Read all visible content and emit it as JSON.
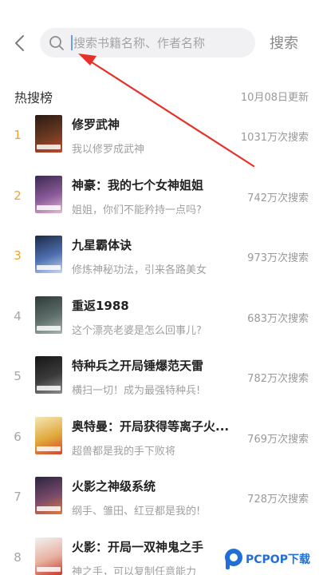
{
  "header": {
    "search_placeholder": "搜索书籍名称、作者名称",
    "search_button": "搜索"
  },
  "hot_search": {
    "title": "热搜榜",
    "updated": "10月08日更新",
    "items": [
      {
        "rank": "1",
        "title": "修罗武神",
        "desc": "我以修罗成武神",
        "count": "1031万次搜索",
        "cover": [
          "#2a1a14",
          "#6b3a22",
          "#c2472a"
        ]
      },
      {
        "rank": "2",
        "title": "神豪：我的七个女神姐姐",
        "desc": "姐姐，你们不能矜持一点吗?",
        "count": "742万次搜索",
        "cover": [
          "#3b2a4e",
          "#8a5a9a",
          "#e6b9d0"
        ]
      },
      {
        "rank": "3",
        "title": "九星霸体诀",
        "desc": "修炼神秘功法，引来各路美女",
        "count": "973万次搜索",
        "cover": [
          "#1c2a44",
          "#4e6fb0",
          "#c9d6f2"
        ]
      },
      {
        "rank": "4",
        "title": "重返1988",
        "desc": "这个漂亮老婆是怎么回事儿?",
        "count": "683万次搜索",
        "cover": [
          "#2f3a3a",
          "#5e6e6a",
          "#a9b4ad"
        ]
      },
      {
        "rank": "5",
        "title": "特种兵之开局锤爆范天雷",
        "desc": "横扫一切！成为最强特种兵!",
        "count": "782万次搜索",
        "cover": [
          "#161616",
          "#3b3b3b",
          "#8c8c8c"
        ]
      },
      {
        "rank": "6",
        "title": "奥特曼：开局获得等离子火...",
        "desc": "超兽都是我的手下败将",
        "count": "769万次搜索",
        "cover": [
          "#f4e7b6",
          "#e0a83a",
          "#d8432f"
        ]
      },
      {
        "rank": "7",
        "title": "火影之神级系统",
        "desc": "纲手、雏田、红豆都是我的!",
        "count": "728万次搜索",
        "cover": [
          "#2b2440",
          "#7a4a6a",
          "#e07a3a"
        ]
      },
      {
        "rank": "8",
        "title": "火影：开局一双神鬼之手",
        "desc": "神之手，可以复制任意能力",
        "count": "",
        "cover": [
          "#f2f2f2",
          "#e8b0a0",
          "#c83a2a"
        ]
      }
    ]
  },
  "watermark": {
    "text": "PCPOP下载"
  }
}
